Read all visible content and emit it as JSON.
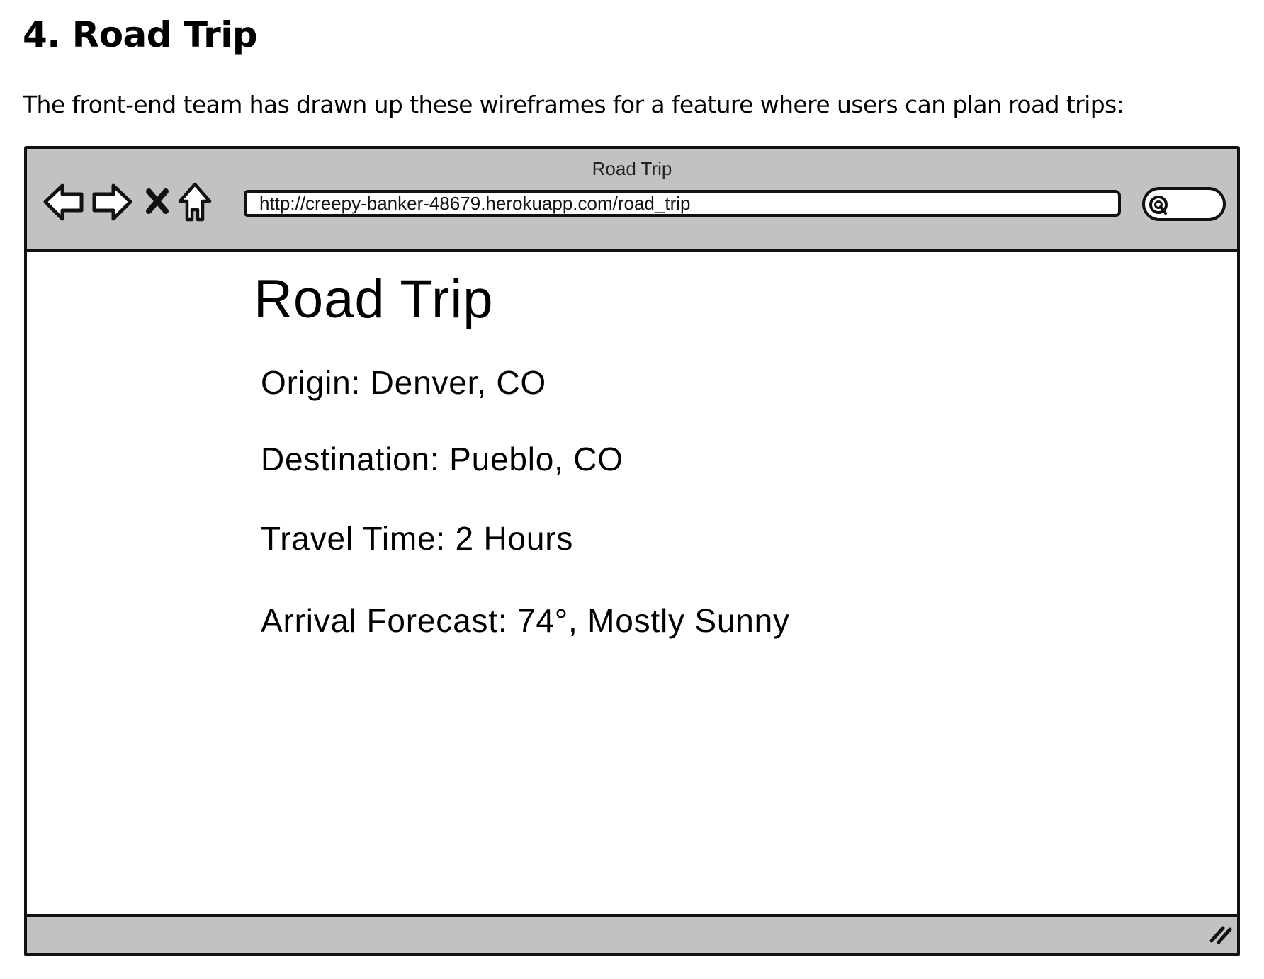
{
  "document": {
    "heading": "4. Road Trip",
    "intro": "The front-end team has drawn up these wireframes for a feature where users can plan road trips:"
  },
  "wireframe": {
    "window_title": "Road Trip",
    "url": "http://creepy-banker-48679.herokuapp.com/road_trip",
    "nav_icons": [
      "back-arrow-icon",
      "forward-arrow-icon",
      "stop-icon",
      "home-icon",
      "search-icon",
      "resize-grip-icon"
    ],
    "page": {
      "title": "Road Trip",
      "origin": "Origin: Denver, CO",
      "destination": "Destination: Pueblo, CO",
      "travel_time": "Travel Time: 2 Hours",
      "arrival_forecast": "Arrival Forecast: 74°, Mostly Sunny"
    }
  },
  "colors": {
    "chrome": "#c2c2c2",
    "border": "#111111",
    "background": "#ffffff"
  }
}
